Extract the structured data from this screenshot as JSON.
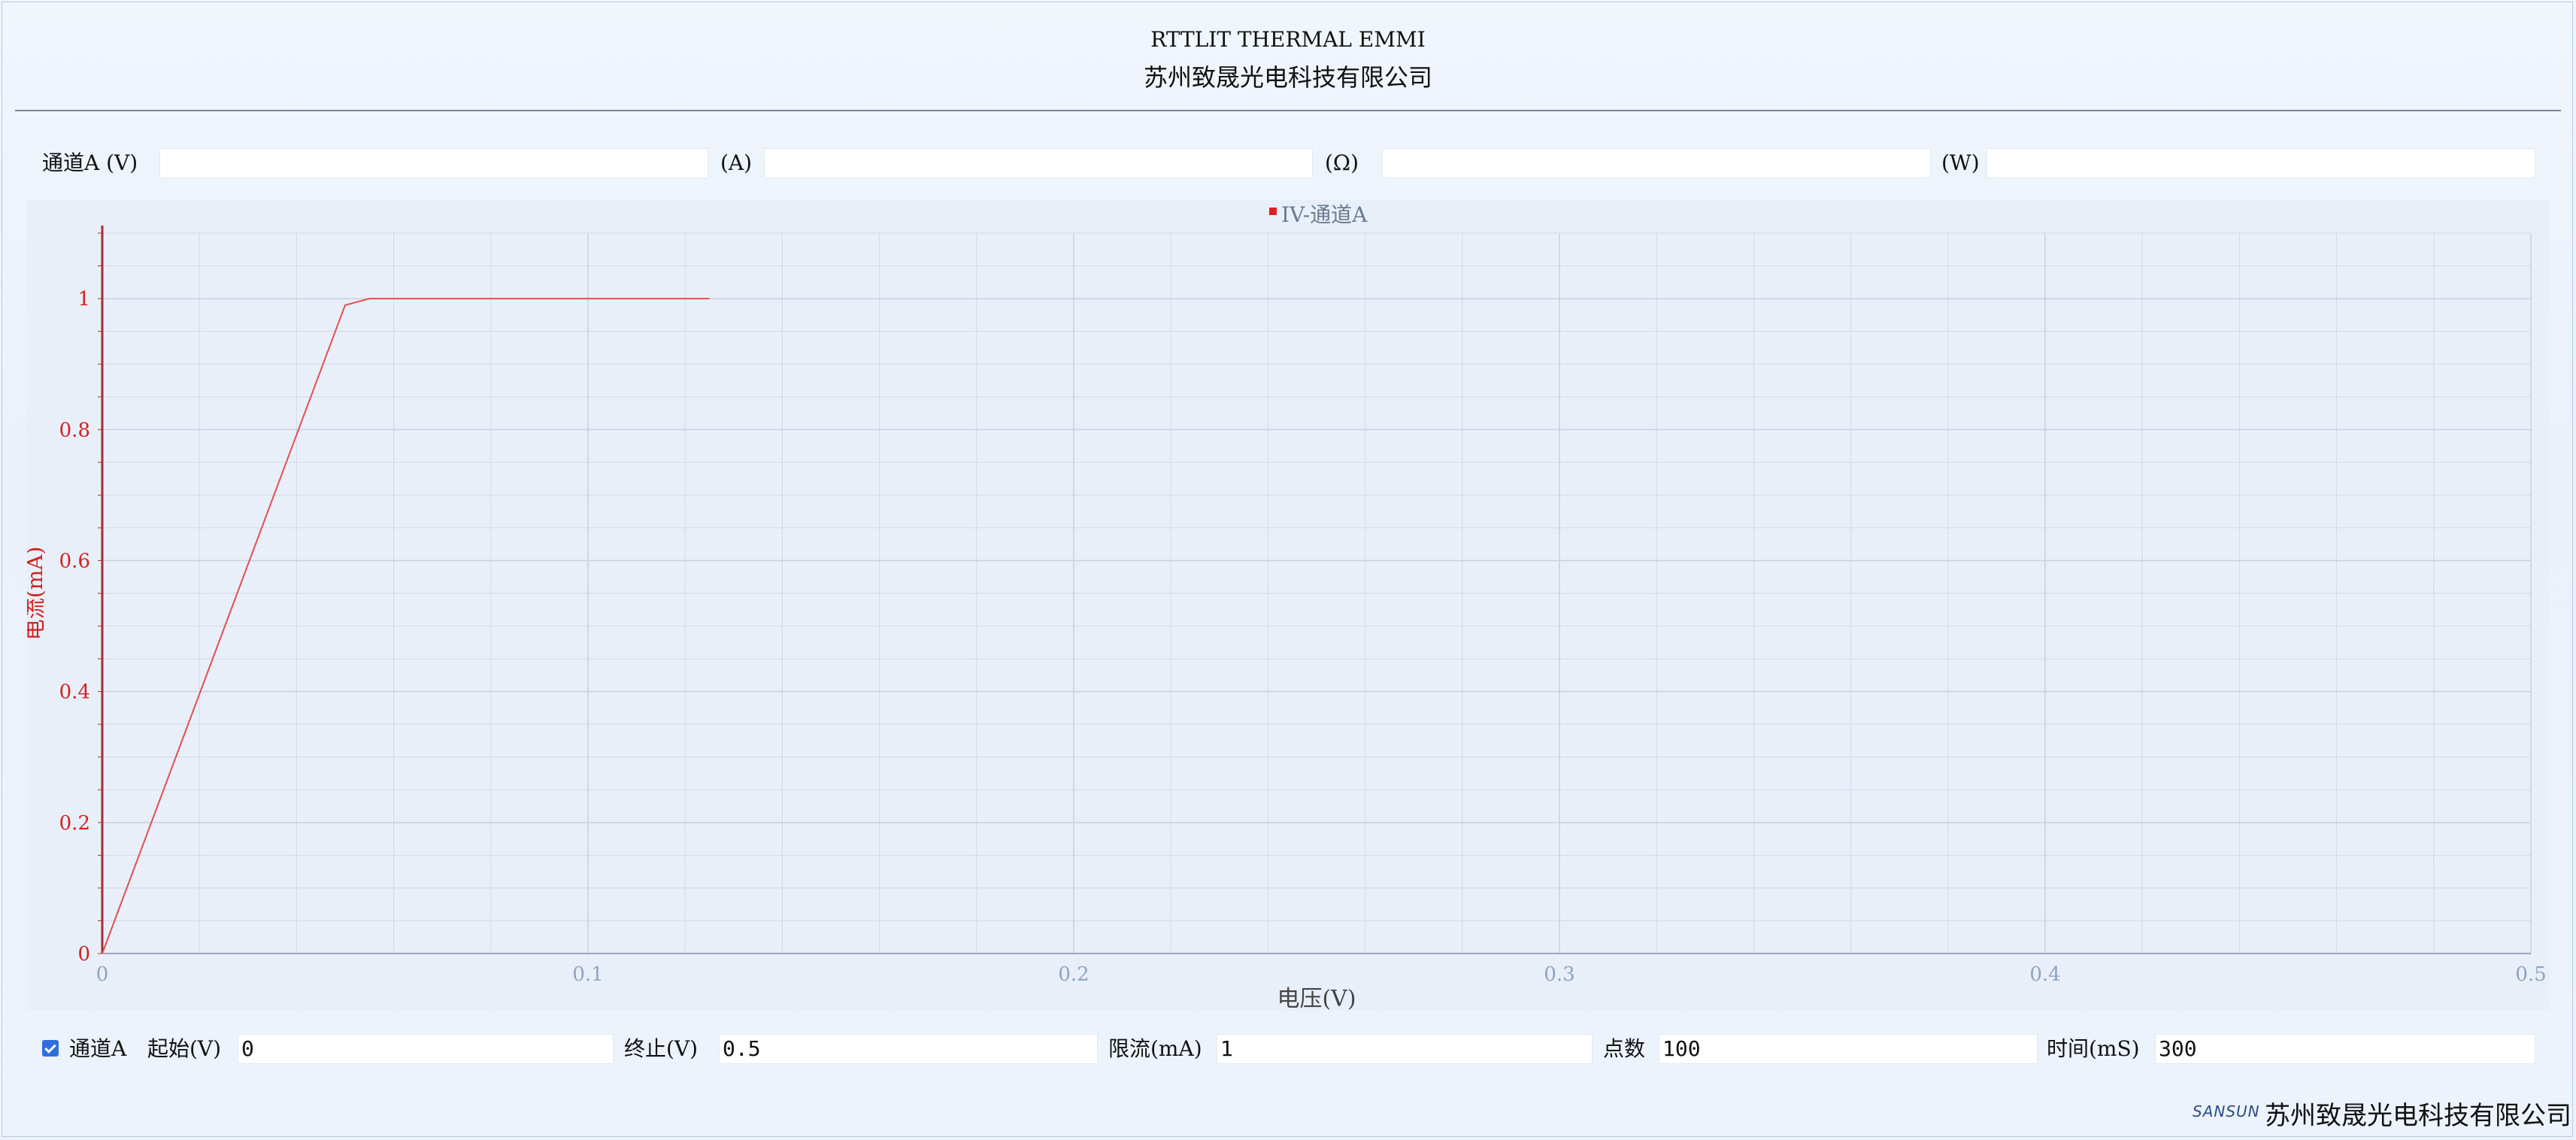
{
  "header": {
    "title": "RTTLIT THERMAL EMMI",
    "company": "苏州致晟光电科技有限公司"
  },
  "readout": {
    "voltage_label": "通道A (V)",
    "voltage_value": "",
    "current_label": "(A)",
    "current_value": "",
    "resistance_label": "(Ω)",
    "resistance_value": "",
    "power_label": "(W)",
    "power_value": ""
  },
  "chart_data": {
    "type": "line",
    "legend": "IV-通道A",
    "legend_position": "top-center",
    "xlabel": "电压(V)",
    "ylabel": "电流(mA)",
    "xlim": [
      0,
      0.5
    ],
    "ylim": [
      0,
      1.1
    ],
    "x_ticks": [
      "0",
      "0.1",
      "0.2",
      "0.3",
      "0.4",
      "0.5"
    ],
    "y_ticks": [
      "0",
      "0.2",
      "0.4",
      "0.6",
      "0.8",
      "1"
    ],
    "grid": true,
    "series": [
      {
        "name": "IV-通道A",
        "color": "#e05050",
        "x": [
          0,
          0.05,
          0.055,
          0.06,
          0.125
        ],
        "y": [
          0,
          0.99,
          1.0,
          1.0,
          1.0
        ]
      }
    ]
  },
  "sweep": {
    "enabled": true,
    "channel_label": "通道A",
    "start_label": "起始(V)",
    "start_value": "0",
    "stop_label": "终止(V)",
    "stop_value": "0.5",
    "limit_label": "限流(mA)",
    "limit_value": "1",
    "points_label": "点数",
    "points_value": "100",
    "time_label": "时间(mS)",
    "time_value": "300"
  },
  "footer": {
    "logo_text": "SANSUN",
    "company": "苏州致晟光电科技有限公司"
  }
}
